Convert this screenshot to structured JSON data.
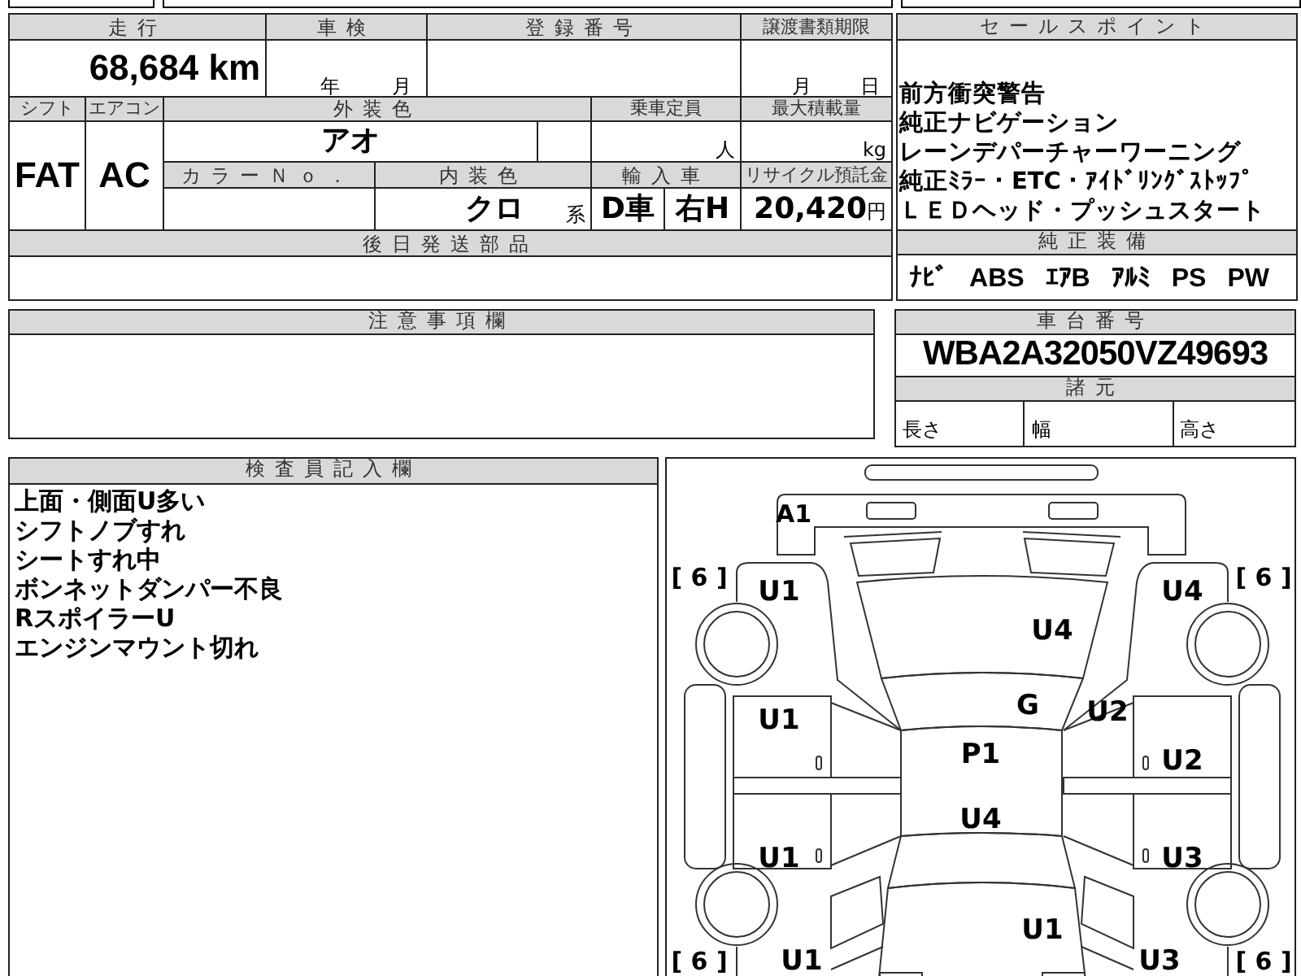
{
  "vehicle_info": {
    "mileage": {
      "label": "走行",
      "value": "68,684",
      "unit": "km"
    },
    "inspection": {
      "label": "車検",
      "year_unit": "年",
      "month_unit": "月"
    },
    "registration_number": {
      "label": "登録番号"
    },
    "transfer_document_deadline": {
      "label": "譲渡書類期限",
      "month_unit": "月",
      "day_unit": "日"
    },
    "shift": {
      "label": "シフト",
      "value": "FAT"
    },
    "air_conditioner": {
      "label": "エアコン",
      "value": "AC"
    },
    "exterior_color": {
      "label": "外装色",
      "value": "アオ"
    },
    "capacity": {
      "label": "乗車定員",
      "unit": "人"
    },
    "max_load": {
      "label": "最大積載量",
      "unit": "kg"
    },
    "color_number": {
      "label": "カラーＮｏ．"
    },
    "interior_color": {
      "label": "内装色",
      "value": "クロ",
      "suffix": "系"
    },
    "imported_car": {
      "label": "輸入車",
      "dealer": "D車",
      "steering": "右H"
    },
    "recycling_deposit": {
      "label": "リサイクル預託金",
      "value": "20,420",
      "unit": "円"
    },
    "later_shipped_parts": {
      "label": "後日発送部品"
    }
  },
  "sales_points": {
    "label": "セールスポイント",
    "lines": [
      "前方衝突警告",
      "純正ナビゲーション",
      "レーンデパーチャーワーニング",
      "純正ﾐﾗｰ・ETC・ｱｲﾄﾞﾘﾝｸﾞｽﾄｯﾌﾟ",
      "ＬＥＤヘッド・プッシュスタート"
    ]
  },
  "genuine_equipment": {
    "label": "純正装備",
    "items": [
      "ﾅﾋﾞ",
      "ABS",
      "ｴｱB",
      "ｱﾙﾐ",
      "PS",
      "PW"
    ]
  },
  "notes": {
    "label": "注意事項欄"
  },
  "chassis_number": {
    "label": "車台番号",
    "value": "WBA2A32050VZ49693"
  },
  "specifications": {
    "label": "諸元",
    "fields": [
      "長さ",
      "幅",
      "高さ"
    ]
  },
  "inspector_notes": {
    "label": "検査員記入欄",
    "lines": [
      "上面・側面U多い",
      "シフトノブすれ",
      "シートすれ中",
      "ボンネットダンパー不良",
      "RスポイラーU",
      "エンジンマウント切れ"
    ]
  },
  "damage_diagram": {
    "tire_marks": [
      "[ 6 ]",
      "[ 6 ]",
      "[ 6 ]",
      "[ 6 ]"
    ],
    "marks": [
      "A1",
      "U1",
      "U4",
      "U4",
      "U1",
      "G",
      "U2",
      "P1",
      "U2",
      "U4",
      "U1",
      "U3",
      "U1",
      "U1",
      "U3"
    ]
  }
}
